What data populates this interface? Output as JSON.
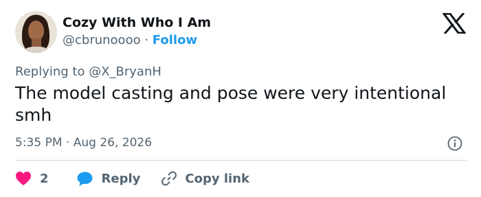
{
  "author": {
    "display_name": "Cozy With Who I Am",
    "handle": "@cbrunoooo",
    "separator": "·",
    "follow_label": "Follow"
  },
  "tweet": {
    "replying_to": "Replying to @X_BryanH",
    "text": "The model casting and pose were very intentional smh",
    "time": "5:35 PM",
    "meta_separator": "·",
    "date": "Aug 26, 2026"
  },
  "actions": {
    "like_count": "2",
    "reply_label": "Reply",
    "copy_link_label": "Copy link"
  },
  "icons": {
    "logo": "x-logo-icon",
    "info": "info-icon",
    "like": "heart-icon",
    "reply": "speech-bubble-icon",
    "copy": "link-icon"
  },
  "colors": {
    "like": "#f91880",
    "reply": "#1d9bf0",
    "follow": "#1d9bf0",
    "muted": "#536471",
    "text": "#0f1419"
  }
}
